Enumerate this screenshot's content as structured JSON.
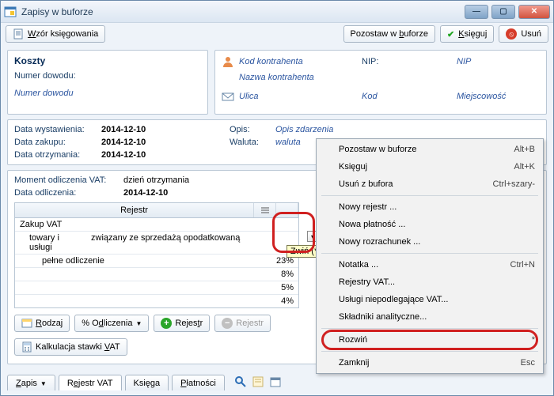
{
  "window": {
    "title": "Zapisy w buforze"
  },
  "toolbar": {
    "wzor": "Wzór księgowania",
    "pozostaw": "Pozostaw w buforze",
    "ksieguj": "Księguj",
    "usun": "Usuń"
  },
  "left": {
    "heading": "Koszty",
    "numer_label": "Numer dowodu:",
    "numer_value": "Numer dowodu"
  },
  "right": {
    "kod_label": "Kod kontrahenta",
    "nip_label": "NIP:",
    "nip_value": "NIP",
    "nazwa_label": "Nazwa kontrahenta",
    "ulica_label": "Ulica",
    "kod_pocz_label": "Kod",
    "miejsc_label": "Miejscowość"
  },
  "meta": {
    "data_wyst_k": "Data wystawienia:",
    "data_wyst_v": "2014-12-10",
    "data_zak_k": "Data zakupu:",
    "data_zak_v": "2014-12-10",
    "data_otrz_k": "Data otrzymania:",
    "data_otrz_v": "2014-12-10",
    "opis_k": "Opis:",
    "opis_v": "Opis zdarzenia",
    "waluta_k": "Waluta:",
    "waluta_v": "waluta"
  },
  "vat": {
    "moment_k": "Moment odliczenia VAT:",
    "moment_v": "dzień otrzymania",
    "data_odl_k": "Data odliczenia:",
    "data_odl_v": "2014-12-10"
  },
  "grid": {
    "header": "Rejestr",
    "row1": "Zakup VAT",
    "row2a": "towary i usługi",
    "row2b": "związany ze sprzedażą opodatkowaną",
    "rows": [
      "pełne odliczenie",
      "",
      ""
    ],
    "percents": [
      "23%",
      "8%",
      "5%",
      "4%"
    ],
    "tooltip": "Zwiń (*)"
  },
  "buttons": {
    "rodzaj": "Rodzaj",
    "odliczenia": "% Odliczenia",
    "rejestr_add": "Rejestr",
    "rejestr_del": "Rejestr",
    "kalk": "Kalkulacja stawki VAT"
  },
  "tabs": {
    "zapis": "Zapis",
    "rejestr": "Rejestr VAT",
    "ksiega": "Księga",
    "platnosci": "Płatności"
  },
  "menu": {
    "pozostaw": "Pozostaw w buforze",
    "pozostaw_s": "Alt+B",
    "ksieguj": "Księguj",
    "ksieguj_s": "Alt+K",
    "usun": "Usuń z bufora",
    "usun_s": "Ctrl+szary-",
    "nrejestr": "Nowy rejestr ...",
    "nplatnosc": "Nowa płatność ...",
    "nrozrach": "Nowy rozrachunek ...",
    "notatka": "Notatka ...",
    "notatka_s": "Ctrl+N",
    "rejestry": "Rejestry VAT...",
    "uslugi": "Usługi niepodlegające VAT...",
    "skladniki": "Składniki analityczne...",
    "rozwin": "Rozwiń",
    "rozwin_s": "*",
    "zamknij": "Zamknij",
    "zamknij_s": "Esc"
  }
}
